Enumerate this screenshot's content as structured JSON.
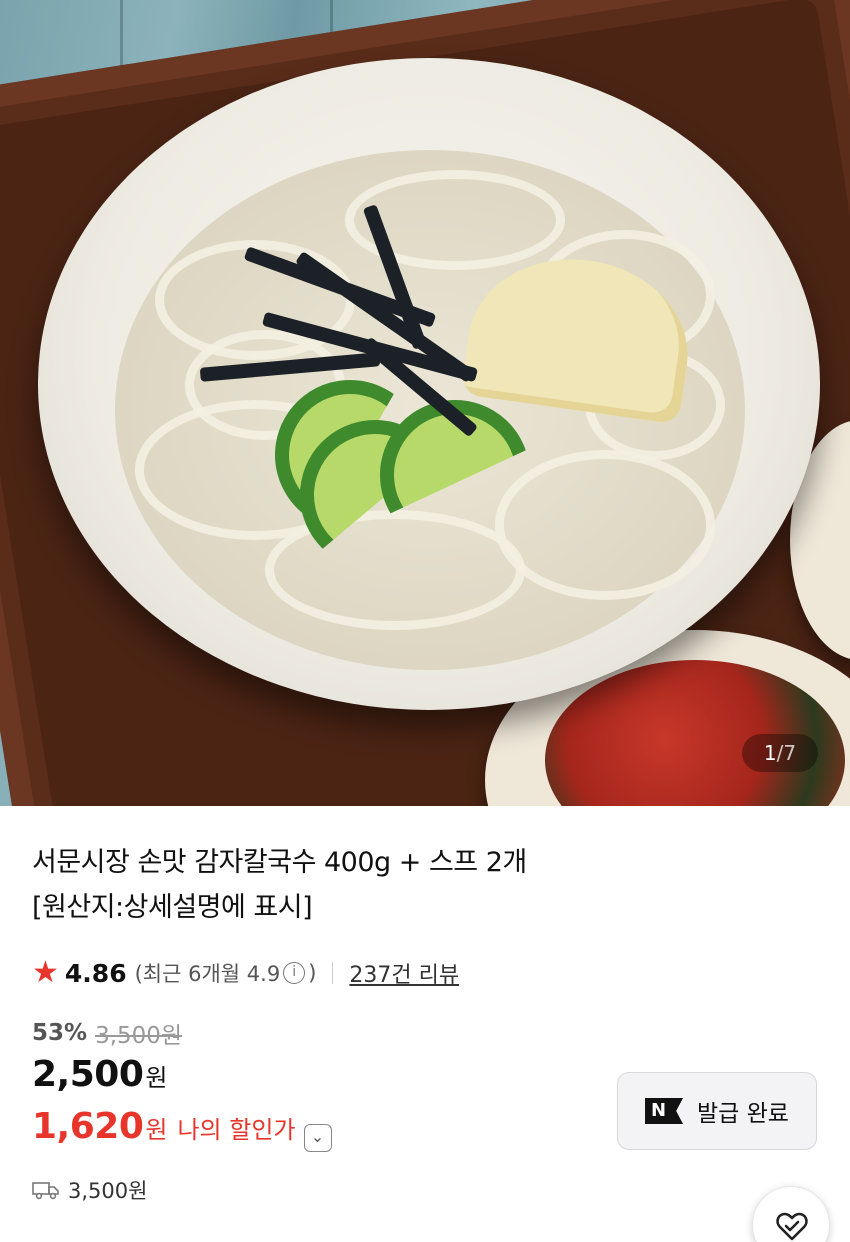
{
  "product_image": {
    "pager_current": "1",
    "pager_separator": "/",
    "pager_total": "7"
  },
  "product": {
    "title_line1": "서문시장 손맛 감자칼국수 400g + 스프 2개",
    "title_line2": "[원산지:상세설명에 표시]"
  },
  "rating": {
    "star_icon": "star-icon",
    "score": "4.86",
    "recent_prefix": "(최근 6개월 4.9",
    "info_symbol": "i",
    "recent_suffix": ")",
    "review_count": "237건 리뷰"
  },
  "pricing": {
    "discount_rate": "53%",
    "original_price": "3,500원",
    "sale_price": "2,500",
    "sale_currency": "원",
    "my_price": "1,620",
    "my_currency": "원",
    "my_price_label": "나의 할인가",
    "expand_icon": "chevron-down-icon"
  },
  "coupon": {
    "brand_mark": "N",
    "label": "발급 완료"
  },
  "shipping": {
    "icon": "truck-icon",
    "fee": "3,500원"
  },
  "actions": {
    "favorite_icon": "heart-check-icon"
  },
  "colors": {
    "accent_red": "#e8352b",
    "text_main": "#111111",
    "text_muted": "#999999"
  }
}
